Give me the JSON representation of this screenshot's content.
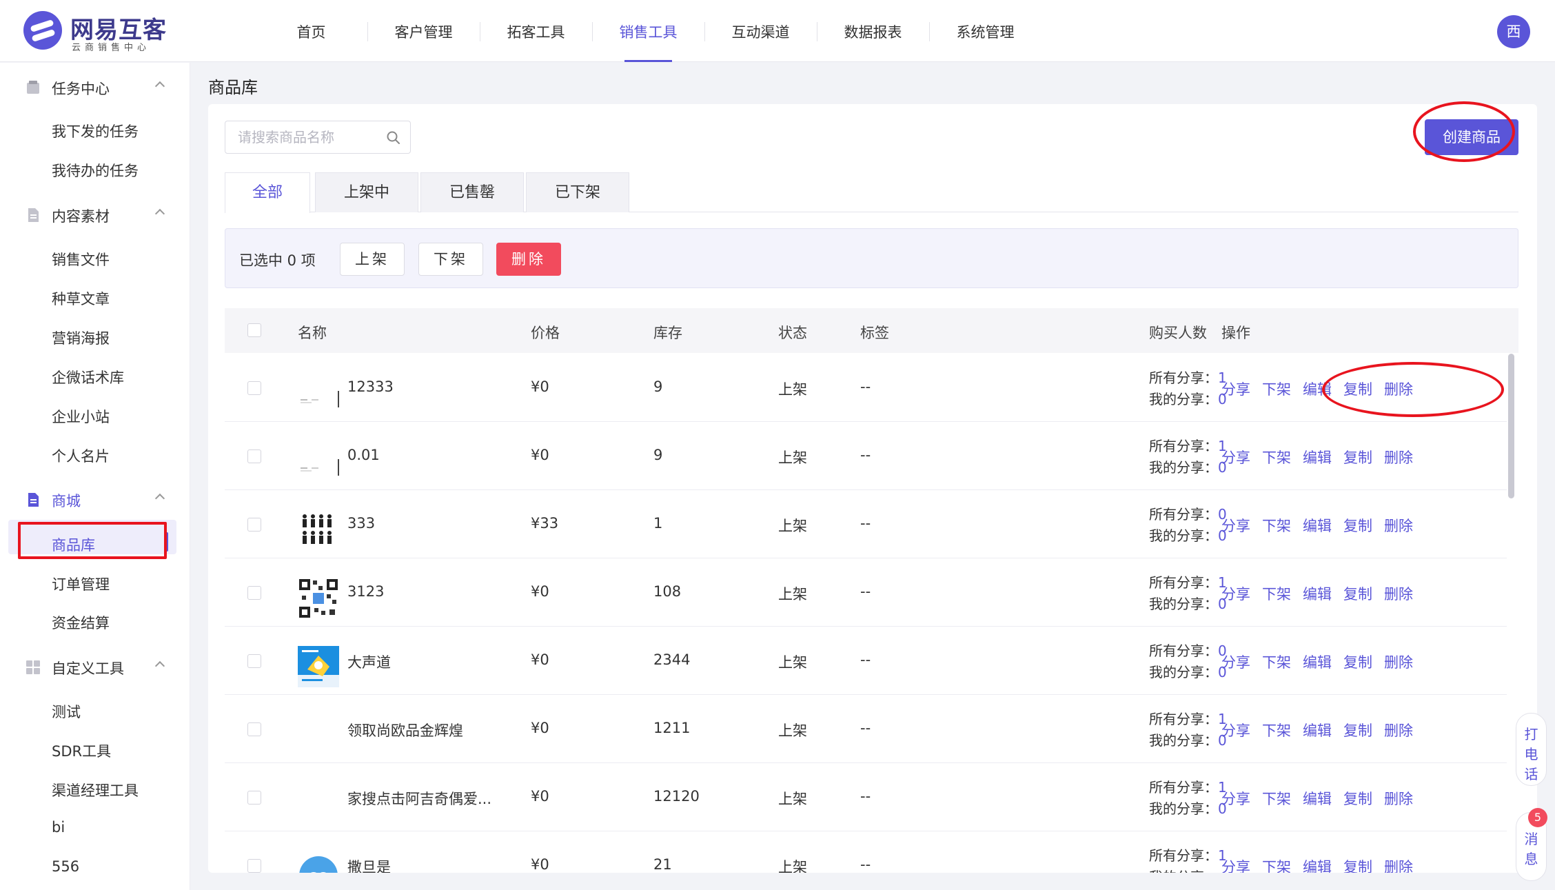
{
  "brand": {
    "name": "网易互客",
    "subtitle": "云商销售中心",
    "color": "#5a55d8"
  },
  "nav": [
    {
      "label": "首页"
    },
    {
      "label": "客户管理"
    },
    {
      "label": "拓客工具"
    },
    {
      "label": "销售工具",
      "active": true
    },
    {
      "label": "互动渠道"
    },
    {
      "label": "数据报表"
    },
    {
      "label": "系统管理"
    }
  ],
  "user": {
    "avatar_text": "西"
  },
  "sidebar": {
    "groups": [
      {
        "label": "任务中心",
        "icon": "task-icon",
        "items": [
          "我下发的任务",
          "我待办的任务"
        ]
      },
      {
        "label": "内容素材",
        "icon": "document-icon",
        "items": [
          "销售文件",
          "种草文章",
          "营销海报",
          "企微话术库",
          "企业小站",
          "个人名片"
        ]
      },
      {
        "label": "商城",
        "icon": "shop-icon",
        "active": true,
        "items": [
          "商品库",
          "订单管理",
          "资金结算"
        ],
        "active_item": "商品库"
      },
      {
        "label": "自定义工具",
        "icon": "grid-icon",
        "items": [
          "测试",
          "SDR工具",
          "渠道经理工具",
          "bi",
          "556"
        ]
      }
    ]
  },
  "page": {
    "title": "商品库"
  },
  "search": {
    "placeholder": "请搜索商品名称",
    "value": ""
  },
  "actions": {
    "create_label": "创建商品"
  },
  "tabs": [
    {
      "label": "全部",
      "active": true
    },
    {
      "label": "上架中"
    },
    {
      "label": "已售罄"
    },
    {
      "label": "已下架"
    }
  ],
  "bulk": {
    "selected_text": "已选中 0 项",
    "up_label": "上架",
    "down_label": "下架",
    "delete_label": "删除"
  },
  "table": {
    "columns": [
      "名称",
      "价格",
      "库存",
      "状态",
      "标签",
      "购买人数",
      "操作"
    ],
    "all_share_label": "所有分享：",
    "my_share_label": "我的分享：",
    "ops": [
      "分享",
      "下架",
      "编辑",
      "复制",
      "删除"
    ],
    "rows": [
      {
        "name": "12333",
        "thumb": "doc",
        "price": "¥0",
        "stock": "9",
        "status": "上架",
        "tag": "--",
        "all_share": "1",
        "my_share": "0"
      },
      {
        "name": "0.01",
        "thumb": "doc",
        "price": "¥0",
        "stock": "9",
        "status": "上架",
        "tag": "--",
        "all_share": "1",
        "my_share": "0"
      },
      {
        "name": "333",
        "thumb": "people",
        "price": "¥33",
        "stock": "1",
        "status": "上架",
        "tag": "--",
        "all_share": "0",
        "my_share": "0"
      },
      {
        "name": "3123",
        "thumb": "qr",
        "price": "¥0",
        "stock": "108",
        "status": "上架",
        "tag": "--",
        "all_share": "1",
        "my_share": "0"
      },
      {
        "name": "大声道",
        "thumb": "poster",
        "price": "¥0",
        "stock": "2344",
        "status": "上架",
        "tag": "--",
        "all_share": "0",
        "my_share": "0"
      },
      {
        "name": "领取尚欧品金辉煌",
        "thumb": "none",
        "price": "¥0",
        "stock": "1211",
        "status": "上架",
        "tag": "--",
        "all_share": "1",
        "my_share": "0"
      },
      {
        "name": "家搜点击阿吉奇偶爱...",
        "thumb": "none",
        "price": "¥0",
        "stock": "12120",
        "status": "上架",
        "tag": "--",
        "all_share": "1",
        "my_share": "0"
      },
      {
        "name": "撒旦是",
        "thumb": "logo",
        "price": "¥0",
        "stock": "21",
        "status": "上架",
        "tag": "--",
        "all_share": "1",
        "my_share": ""
      }
    ]
  },
  "float": {
    "call_label": "打\n电\n话",
    "msg_label": "消\n息",
    "msg_badge": "5"
  }
}
